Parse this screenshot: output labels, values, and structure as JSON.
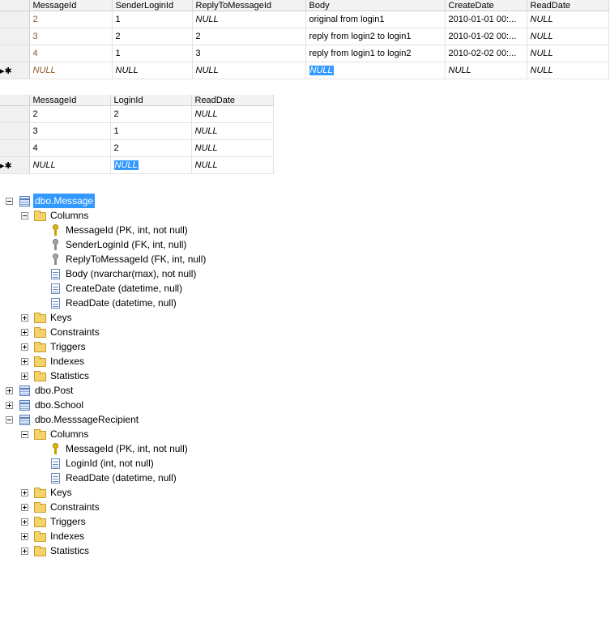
{
  "grid1": {
    "columns": [
      "MessageId",
      "SenderLoginId",
      "ReplyToMessageId",
      "Body",
      "CreateDate",
      "ReadDate"
    ],
    "rows": [
      [
        "2",
        "1",
        "NULL",
        "original from login1",
        "2010-01-01 00:...",
        "NULL"
      ],
      [
        "3",
        "2",
        "2",
        "reply from login2 to login1",
        "2010-01-02 00:...",
        "NULL"
      ],
      [
        "4",
        "1",
        "3",
        "reply from login1 to login2",
        "2010-02-02 00:...",
        "NULL"
      ],
      [
        "NULL",
        "NULL",
        "NULL",
        "NULL",
        "NULL",
        "NULL"
      ]
    ],
    "new_row_marker": "▸✱"
  },
  "grid2": {
    "columns": [
      "MessageId",
      "LoginId",
      "ReadDate"
    ],
    "rows": [
      [
        "2",
        "2",
        "NULL"
      ],
      [
        "3",
        "1",
        "NULL"
      ],
      [
        "4",
        "2",
        "NULL"
      ],
      [
        "NULL",
        "NULL",
        "NULL"
      ]
    ],
    "new_row_marker": "▸✱"
  },
  "tree": {
    "message_table": "dbo.Message",
    "message_columns_folder": "Columns",
    "message_columns": [
      {
        "label": "MessageId (PK, int, not null)",
        "icon": "primary-key-icon"
      },
      {
        "label": "SenderLoginId (FK, int, null)",
        "icon": "foreign-key-icon"
      },
      {
        "label": "ReplyToMessageId (FK, int, null)",
        "icon": "foreign-key-icon"
      },
      {
        "label": "Body (nvarchar(max), not null)",
        "icon": "column-icon"
      },
      {
        "label": "CreateDate (datetime, null)",
        "icon": "column-icon"
      },
      {
        "label": "ReadDate (datetime, null)",
        "icon": "column-icon"
      }
    ],
    "message_folders": [
      "Keys",
      "Constraints",
      "Triggers",
      "Indexes",
      "Statistics"
    ],
    "post_table": "dbo.Post",
    "school_table": "dbo.School",
    "recipient_table": "dbo.MesssageRecipient",
    "recipient_columns_folder": "Columns",
    "recipient_columns": [
      {
        "label": "MessageId (PK, int, not null)",
        "icon": "primary-key-icon"
      },
      {
        "label": "LoginId (int, not null)",
        "icon": "column-icon"
      },
      {
        "label": "ReadDate (datetime, null)",
        "icon": "column-icon"
      }
    ],
    "recipient_folders": [
      "Keys",
      "Constraints",
      "Triggers",
      "Indexes",
      "Statistics"
    ]
  },
  "colors": {
    "selection": "#3399ff",
    "id_text": "#8b5a2b"
  }
}
